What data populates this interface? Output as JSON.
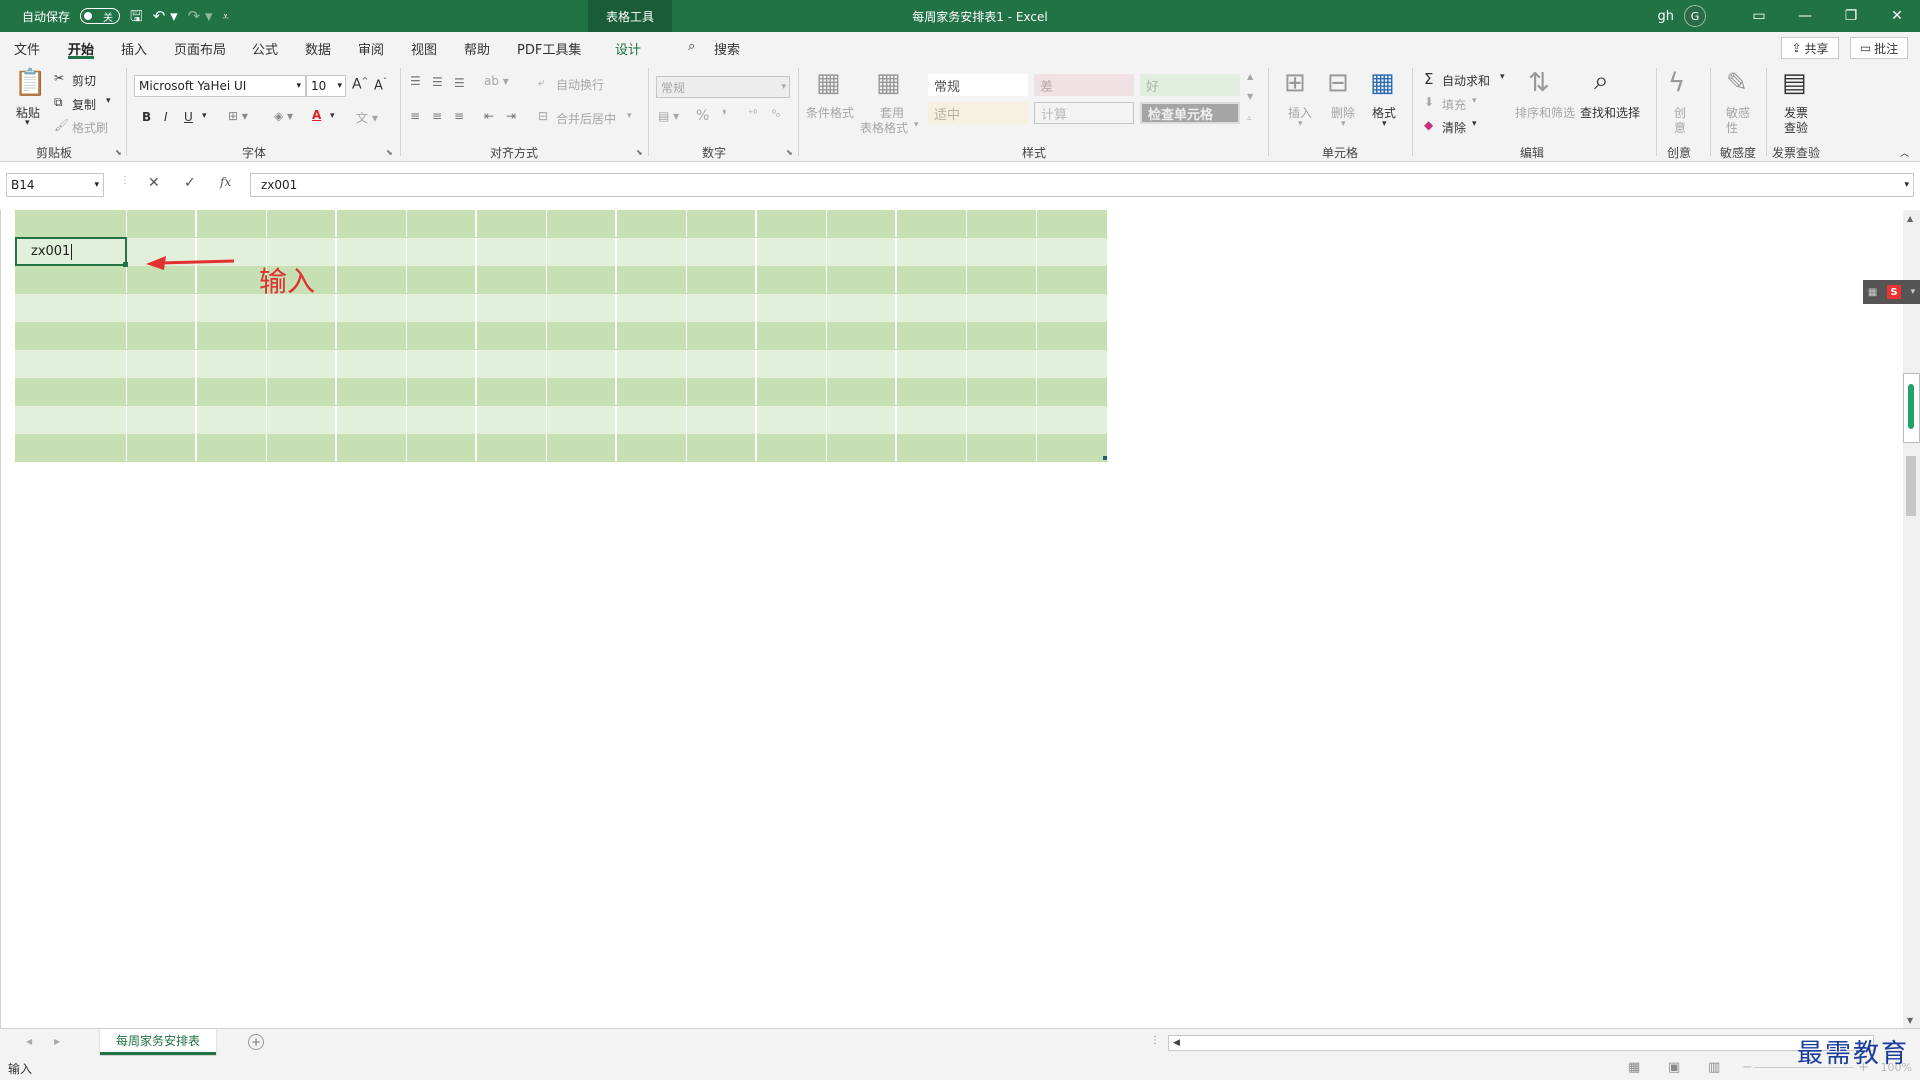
{
  "titlebar": {
    "autosave_label": "自动保存",
    "autosave_state": "关",
    "tools_label": "表格工具",
    "title": "每周家务安排表1 - Excel",
    "user": "gh",
    "avatar_initial": "G"
  },
  "menu": {
    "tabs": [
      "文件",
      "开始",
      "插入",
      "页面布局",
      "公式",
      "数据",
      "审阅",
      "视图",
      "帮助",
      "PDF工具集",
      "设计"
    ],
    "active": "开始",
    "search_label": "搜索",
    "share_label": "共享",
    "comment_label": "批注"
  },
  "ribbon": {
    "clipboard": {
      "paste": "粘贴",
      "cut": "剪切",
      "copy": "复制",
      "format_painter": "格式刷",
      "label": "剪贴板"
    },
    "font": {
      "name": "Microsoft YaHei UI",
      "size": "10",
      "label": "字体"
    },
    "alignment": {
      "wrap": "自动换行",
      "merge": "合并后居中",
      "label": "对齐方式"
    },
    "number": {
      "format": "常规",
      "label": "数字"
    },
    "styles": {
      "conditional": "条件格式",
      "table_format_1": "套用",
      "table_format_2": "表格格式",
      "cells": [
        "常规",
        "差",
        "好",
        "适中",
        "计算",
        "检查单元格"
      ],
      "label": "样式"
    },
    "cells": {
      "insert": "插入",
      "delete": "删除",
      "format": "格式",
      "label": "单元格"
    },
    "editing": {
      "autosum": "自动求和",
      "fill": "填充",
      "clear": "清除",
      "sort": "排序和筛选",
      "find": "查找和选择",
      "label": "编辑"
    },
    "creative": {
      "btn_line1": "创",
      "btn_line2": "意",
      "label": "创意"
    },
    "sensitivity": {
      "btn_line1": "敏感",
      "btn_line2": "性",
      "label": "敏感度"
    },
    "invoice": {
      "btn_line1": "发票",
      "btn_line2": "查验",
      "label": "发票查验"
    }
  },
  "formula_bar": {
    "name_box": "B14",
    "fx": "fx",
    "value": "zx001"
  },
  "sheet": {
    "active_cell_value": "zx001",
    "annotation": "输入"
  },
  "colors": {
    "excel_green": "#217346",
    "band_dark": "#c6e0b4",
    "band_light": "#e2efda",
    "annotation_red": "#e03030"
  },
  "sheet_tabs": {
    "active": "每周家务安排表",
    "add": "+"
  },
  "status": {
    "mode": "输入",
    "zoom": "100%"
  },
  "watermark": "最需教育"
}
